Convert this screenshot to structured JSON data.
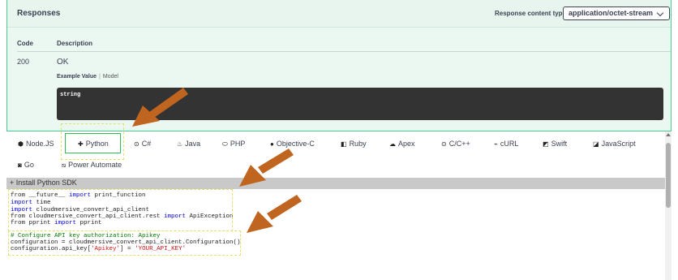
{
  "responses": {
    "title": "Responses",
    "content_type_label": "Response content type",
    "content_type_value": "application/octet-stream",
    "columns": {
      "code": "Code",
      "description": "Description"
    },
    "rows": [
      {
        "code": "200",
        "description": "OK"
      }
    ],
    "example_tabs": {
      "active": "Example Value",
      "other": "Model"
    },
    "example_value": "string"
  },
  "languages": [
    {
      "label": "Node.JS",
      "icon": "nodejs-icon"
    },
    {
      "label": "Python",
      "icon": "python-icon",
      "selected": true
    },
    {
      "label": "C#",
      "icon": "csharp-icon"
    },
    {
      "label": "Java",
      "icon": "java-icon"
    },
    {
      "label": "PHP",
      "icon": "php-icon"
    },
    {
      "label": "Objective-C",
      "icon": "apple-icon"
    },
    {
      "label": "Ruby",
      "icon": "ruby-icon"
    },
    {
      "label": "Apex",
      "icon": "apex-icon"
    },
    {
      "label": "C/C++",
      "icon": "cpp-icon"
    },
    {
      "label": "cURL",
      "icon": "curl-icon"
    },
    {
      "label": "Swift",
      "icon": "swift-icon"
    },
    {
      "label": "JavaScript",
      "icon": "javascript-icon"
    },
    {
      "label": "Go",
      "icon": "go-icon"
    },
    {
      "label": "Power Automate",
      "icon": "power-automate-icon"
    }
  ],
  "sdk": {
    "install_label": "+ Install Python SDK",
    "code": {
      "l1a": "from __future__ ",
      "l1b": "import",
      "l1c": " print_function",
      "l2a": "import",
      "l2b": " time",
      "l3a": "import",
      "l3b": " cloudmersive_convert_api_client",
      "l4a": "from cloudmersive_convert_api_client.rest ",
      "l4b": "import",
      "l4c": " ApiException",
      "l5a": "from pprint ",
      "l5b": "import",
      "l5c": " pprint",
      "l6": "# Configure API key authorization: Apikey",
      "l7": "configuration = cloudmersive_convert_api_client.Configuration()",
      "l8a": "configuration.api_key[",
      "l8b": "'Apikey'",
      "l8c": "] = ",
      "l8d": "'YOUR_API_KEY'"
    }
  },
  "colors": {
    "accent_green": "#49cc90",
    "annotation_arrow": "#c0651f",
    "highlight_dash": "#e3e070"
  }
}
